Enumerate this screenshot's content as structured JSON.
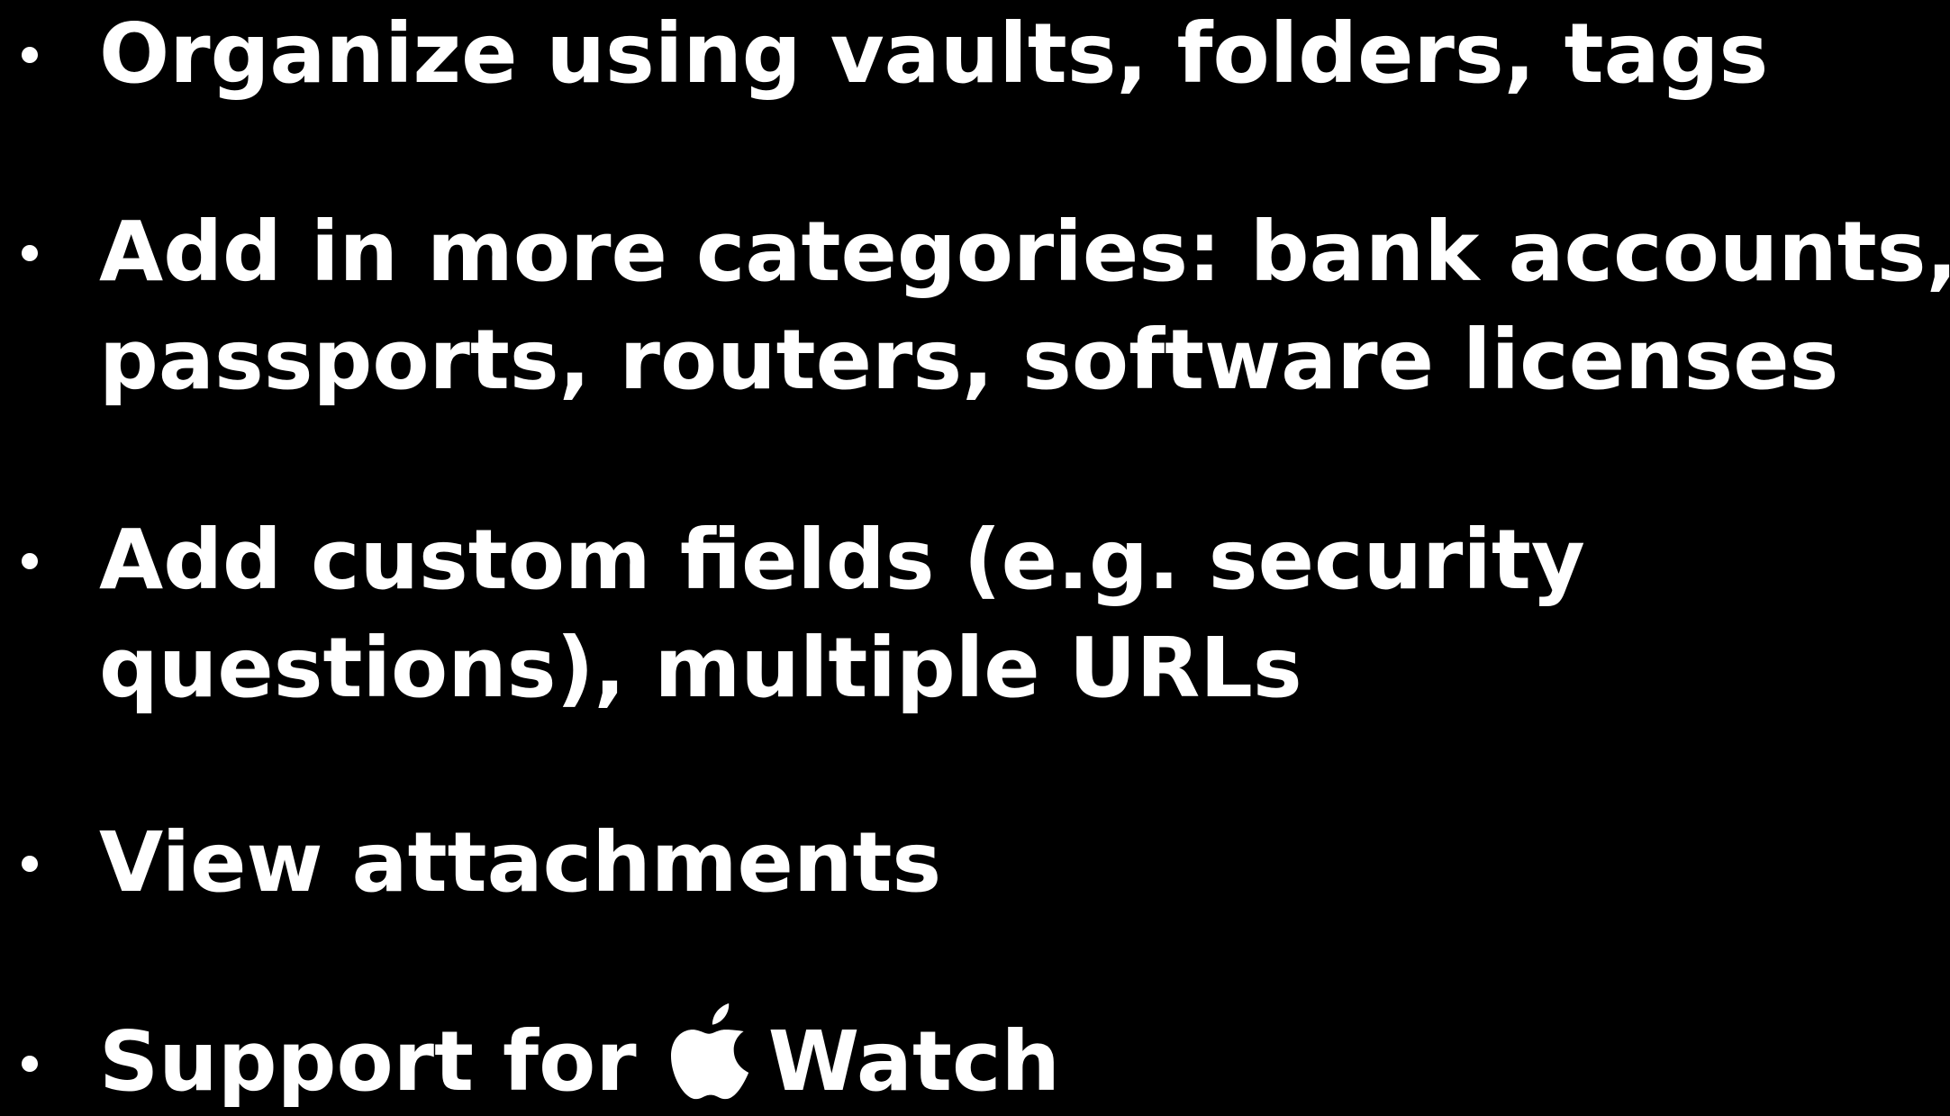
{
  "bullets": [
    {
      "lines": [
        "Organize using vaults, folders, tags"
      ]
    },
    {
      "lines": [
        "Add in more categories: bank accounts,",
        "passports, routers, software licenses"
      ]
    },
    {
      "lines": [
        "Add custom fields (e.g. security",
        "questions), multiple URLs"
      ]
    },
    {
      "lines": [
        "View attachments"
      ]
    },
    {
      "before_icon": "Support for",
      "icon": "apple-logo-icon",
      "after_icon": "Watch"
    }
  ],
  "colors": {
    "background": "#000000",
    "text": "#ffffff"
  }
}
